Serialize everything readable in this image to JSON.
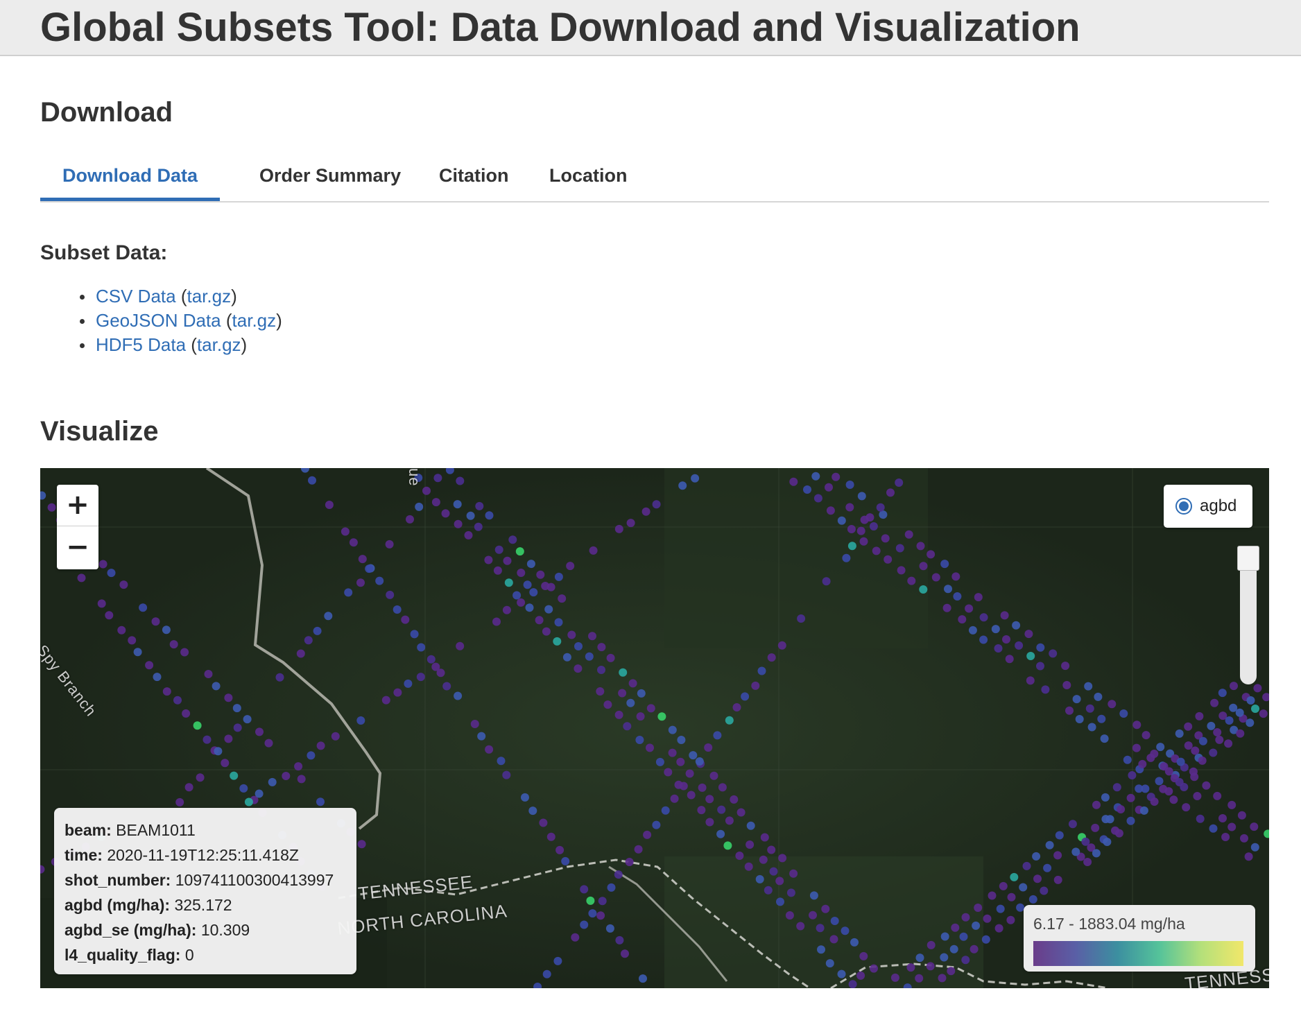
{
  "header": {
    "title": "Global Subsets Tool: Data Download and Visualization"
  },
  "download": {
    "heading": "Download",
    "tabs": [
      {
        "label": "Download Data",
        "active": true
      },
      {
        "label": "Order Summary",
        "active": false
      },
      {
        "label": "Citation",
        "active": false
      },
      {
        "label": "Location",
        "active": false
      }
    ],
    "subset_label": "Subset Data:",
    "items": [
      {
        "name": "CSV Data",
        "archive": "tar.gz"
      },
      {
        "name": "GeoJSON Data",
        "archive": "tar.gz"
      },
      {
        "name": "HDF5 Data",
        "archive": "tar.gz"
      }
    ]
  },
  "visualize": {
    "heading": "Visualize",
    "zoom_in": "+",
    "zoom_out": "−",
    "layer": {
      "label": "agbd",
      "selected": true
    },
    "map_labels": {
      "stream": "Spy Branch",
      "state_1": "TENNESSEE",
      "state_2": "NORTH CAROLINA",
      "state_3": "TENNESSEE",
      "road_fragment": "ue"
    },
    "popup": {
      "rows": [
        {
          "key": "beam:",
          "value": "BEAM1011"
        },
        {
          "key": "time:",
          "value": "2020-11-19T12:25:11.418Z"
        },
        {
          "key": "shot_number:",
          "value": "109741100300413997"
        },
        {
          "key": "agbd (mg/ha):",
          "value": "325.172"
        },
        {
          "key": "agbd_se (mg/ha):",
          "value": "10.309"
        },
        {
          "key": "l4_quality_flag:",
          "value": "0"
        }
      ]
    },
    "legend": {
      "text": "6.17 - 1883.04 mg/ha",
      "colors": [
        "#6a3d8a",
        "#5a5fa6",
        "#3c8fa0",
        "#55c39a",
        "#b5e07a",
        "#f1e76a"
      ]
    }
  },
  "colors": {
    "accent": "#2f6db5",
    "point_purple": "#5a2a8c",
    "point_blue": "#3d5bb0",
    "point_teal": "#2aa8a0",
    "point_green": "#39d16a"
  }
}
